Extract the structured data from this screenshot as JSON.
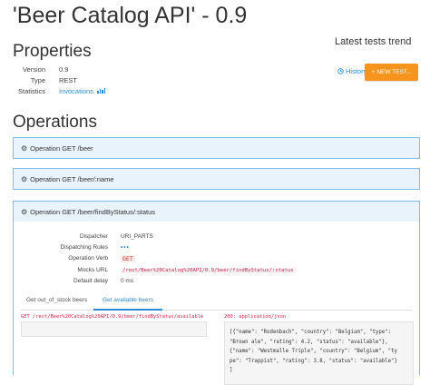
{
  "page": {
    "title": "'Beer Catalog API' - 0.9"
  },
  "properties": {
    "heading": "Properties",
    "version_label": "Version",
    "version_value": "0.9",
    "type_label": "Type",
    "type_value": "REST",
    "statistics_label": "Statistics",
    "statistics_link": "Invocations"
  },
  "tests": {
    "heading": "Latest tests trend",
    "history_link": "History",
    "new_test_button": "NEW TEST..."
  },
  "operations": {
    "heading": "Operations",
    "items": [
      {
        "label": "Operation GET /beer"
      },
      {
        "label": "Operation GET /beer/:name"
      },
      {
        "label": "Operation GET /beer/findByStatus/:status"
      }
    ],
    "details": {
      "dispatcher_label": "Dispatcher",
      "dispatcher_value": "URI_PARTS",
      "dispatching_rules_label": "Dispatching Rules",
      "dispatching_rules_value": "•••",
      "verb_label": "Operation Verb",
      "verb_value": "GET",
      "mocks_url_label": "Mocks URL",
      "mocks_url_value": "/rest/Beer%20Catalog%20API/0.9/beer/findByStatus/:status",
      "default_delay_label": "Default delay",
      "default_delay_value": "0 ms"
    },
    "tabs": [
      {
        "label": "Get out_of_stock beers"
      },
      {
        "label": "Get available beers"
      }
    ],
    "request_line": "GET /rest/Beer%20Catalog%20API/0.9/beer/findByStatus/available",
    "response_line": "200: application/json",
    "response_body": "[{\"name\": \"Rodenbach\", \"country\": \"Belgium\", \"type\":\n\"Brown ale\", \"rating\": 4.2, \"status\": \"available\"},\n{\"name\": \"Westmalle Triple\", \"country\": \"Belgium\", \"ty\npe\": \"Trappist\", \"rating\": 3.8, \"status\": \"available\"}\n]"
  },
  "colors": {
    "accent_blue": "#2a8bd3",
    "panel_border": "#7fbde8",
    "panel_header_bg": "#e8f3fb",
    "orange_button": "#f7941d",
    "code_pink": "#c7254e"
  },
  "icons": {
    "gear": "gear-icon",
    "clock": "clock-icon",
    "bar_chart": "bar-chart-icon",
    "plus": "plus-icon"
  }
}
